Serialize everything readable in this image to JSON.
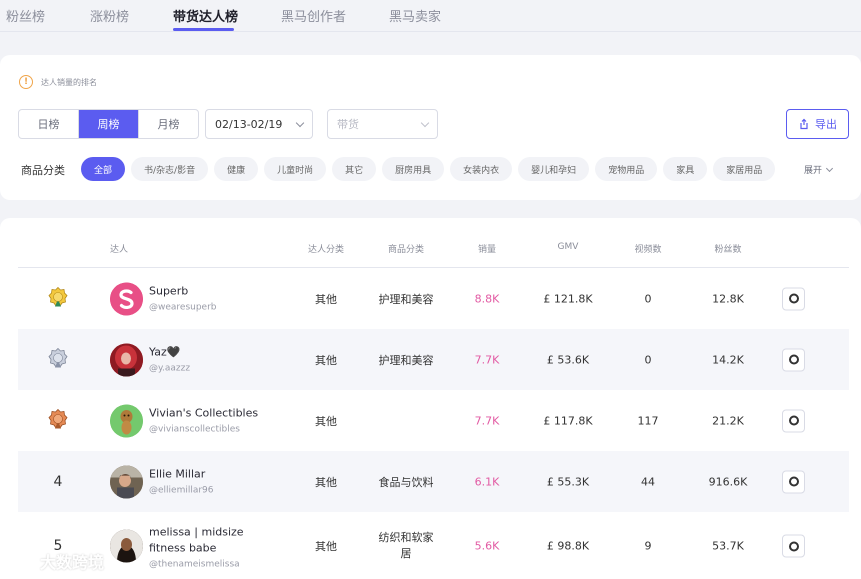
{
  "tabs": [
    {
      "label": "粉丝榜",
      "active": false
    },
    {
      "label": "涨粉榜",
      "active": false
    },
    {
      "label": "带货达人榜",
      "active": true
    },
    {
      "label": "黑马创作者",
      "active": false
    },
    {
      "label": "黑马卖家",
      "active": false
    }
  ],
  "notice": {
    "icon": "!",
    "text": "达人销量的排名"
  },
  "period": {
    "options": [
      "日榜",
      "周榜",
      "月榜"
    ],
    "selected": "周榜"
  },
  "date_select": {
    "value": "02/13-02/19"
  },
  "category_select": {
    "placeholder": "带货"
  },
  "export": {
    "label": "导出"
  },
  "category": {
    "label": "商品分类",
    "chips": [
      "全部",
      "书/杂志/影音",
      "健康",
      "儿童时尚",
      "其它",
      "厨房用具",
      "女装内衣",
      "婴儿和孕妇",
      "宠物用品",
      "家具",
      "家居用品"
    ],
    "expand_label": "展开"
  },
  "table": {
    "headers": {
      "creator": "达人",
      "creator_category": "达人分类",
      "product_category": "商品分类",
      "sales": "销量",
      "gmv": "GMV",
      "videos": "视频数",
      "fans": "粉丝数"
    },
    "rows": [
      {
        "rank": "1",
        "medal": "gold",
        "name": "Superb",
        "handle": "@wearesuperb",
        "creator_category": "其他",
        "product_category": "护理和美容",
        "sales": "8.8K",
        "gmv": "£ 121.8K",
        "videos": "0",
        "fans": "12.8K"
      },
      {
        "rank": "2",
        "medal": "silver",
        "name": "Yaz🖤",
        "handle": "@y.aazzz",
        "creator_category": "其他",
        "product_category": "护理和美容",
        "sales": "7.7K",
        "gmv": "£ 53.6K",
        "videos": "0",
        "fans": "14.2K"
      },
      {
        "rank": "3",
        "medal": "bronze",
        "name": "Vivian's Collectibles",
        "handle": "@vivianscollectibles",
        "creator_category": "其他",
        "product_category": "",
        "sales": "7.7K",
        "gmv": "£ 117.8K",
        "videos": "117",
        "fans": "21.2K"
      },
      {
        "rank": "4",
        "medal": "",
        "name": "Ellie Millar",
        "handle": "@elliemillar96",
        "creator_category": "其他",
        "product_category": "食品与饮料",
        "sales": "6.1K",
        "gmv": "£ 55.3K",
        "videos": "44",
        "fans": "916.6K"
      },
      {
        "rank": "5",
        "medal": "",
        "name": "melissa | midsize fitness babe",
        "handle": "@thenameismelissa",
        "creator_category": "其他",
        "product_category": "纺织和软家居",
        "sales": "5.6K",
        "gmv": "£ 98.8K",
        "videos": "9",
        "fans": "53.7K"
      }
    ]
  },
  "watermark": {
    "text": "大数跨境"
  },
  "colors": {
    "accent": "#5b5cf0",
    "sales": "#e25aa3",
    "notice": "#f0a54a"
  }
}
